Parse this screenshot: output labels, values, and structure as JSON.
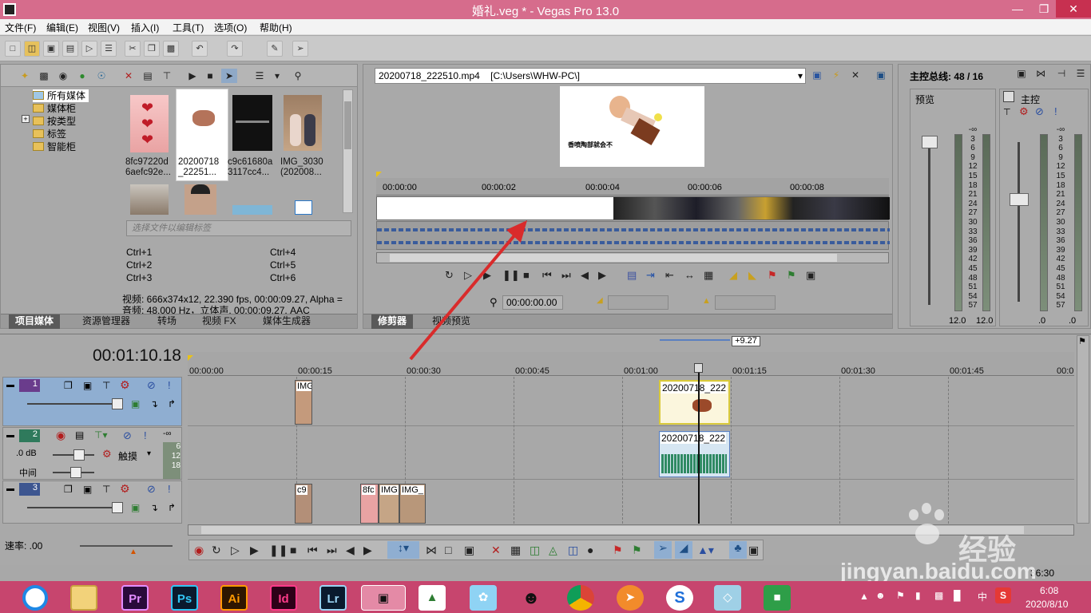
{
  "window": {
    "title": "婚礼.veg * - Vegas Pro 13.0"
  },
  "menu": [
    "文件(F)",
    "编辑(E)",
    "视图(V)",
    "插入(I)",
    "工具(T)",
    "选项(O)",
    "帮助(H)"
  ],
  "project_media": {
    "tree": [
      "所有媒体",
      "媒体柜",
      "按类型",
      "标签",
      "智能柜"
    ],
    "thumbs": [
      {
        "l1": "8fc97220d",
        "l2": "6aefc92e..."
      },
      {
        "l1": "20200718",
        "l2": "_22251..."
      },
      {
        "l1": "c9c61680a",
        "l2": "3117cc4..."
      },
      {
        "l1": "IMG_3030",
        "l2": "(202008..."
      }
    ],
    "tag_placeholder": "选择文件以编辑标签",
    "shortcuts": [
      "Ctrl+1",
      "Ctrl+4",
      "Ctrl+2",
      "Ctrl+5",
      "Ctrl+3",
      "Ctrl+6"
    ],
    "video_info": "视频: 666x374x12, 22.390 fps, 00:00:09.27, Alpha =",
    "audio_info": "音频: 48,000 Hz，立体声, 00:00:09.27, AAC",
    "tabs": [
      "项目媒体",
      "资源管理器",
      "转场",
      "视频 FX",
      "媒体生成器"
    ]
  },
  "trimmer": {
    "file": "20200718_222510.mp4",
    "path": "[C:\\Users\\WHW-PC\\]",
    "preview_caption": "香喷陶部就会不",
    "ruler": [
      "00:00:00",
      "00:00:02",
      "00:00:04",
      "00:00:06",
      "00:00:08"
    ],
    "timecode": "00:00:00.00",
    "tabs": [
      "修剪器",
      "视频预览"
    ]
  },
  "mixer": {
    "title": "主控总线: 48 / 16",
    "preview_label": "预览",
    "master_label": "主控",
    "scale": [
      "-∞",
      "3",
      "6",
      "9",
      "12",
      "15",
      "18",
      "21",
      "24",
      "27",
      "30",
      "33",
      "36",
      "39",
      "42",
      "45",
      "48",
      "51",
      "54",
      "57"
    ],
    "left_vals": [
      "12.0",
      "12.0"
    ],
    "right_vals": [
      ".0",
      ".0"
    ]
  },
  "timeline": {
    "timecode": "00:01:10.18",
    "length_badge": "+9.27",
    "ruler": [
      "00:00:00",
      "00:00:15",
      "00:00:30",
      "00:00:45",
      "00:01:00",
      "00:01:15",
      "00:01:30",
      "00:01:45",
      "00:0"
    ],
    "tracks": [
      {
        "num": "1"
      },
      {
        "num": "2",
        "db": ".0 dB",
        "pan": "中间",
        "mode": "触摸",
        "meter": [
          "-∞",
          "6",
          "12",
          "18"
        ]
      },
      {
        "num": "3"
      }
    ],
    "clips": {
      "t1a": "IMG",
      "t1b": "20200718_222",
      "t2": "20200718_222",
      "t3a": "c9",
      "t3b": "8fc",
      "t3c": "IMG",
      "t3d": "IMG_"
    },
    "rate": "速率: .00",
    "status_time": "36:30"
  },
  "taskbar": {
    "apps": [
      "Pr",
      "Ps",
      "Ai",
      "Id",
      "Lr"
    ],
    "time": "6:08",
    "date": "2020/8/10",
    "ime": "中"
  },
  "watermark": {
    "site": "jingyan.baidu.com",
    "brand": "经验"
  },
  "colors": {
    "title": "#d66c8c",
    "taskbar": "#c7456e",
    "arrow": "#d92b2b",
    "selected_track": "#8faed1"
  }
}
